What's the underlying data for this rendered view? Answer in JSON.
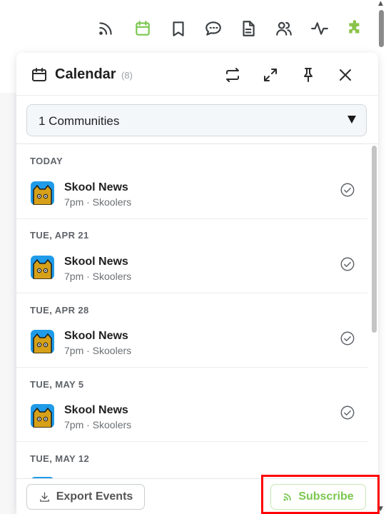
{
  "toolbar": {
    "icons": [
      "rss-icon",
      "calendar-icon",
      "bookmark-icon",
      "chat-icon",
      "document-icon",
      "users-icon",
      "activity-icon",
      "puzzle-icon"
    ],
    "active_icon": "calendar-icon",
    "active_color": "#7ac74f"
  },
  "panel": {
    "title": "Calendar",
    "count": "(8)",
    "header_icons": [
      "calendar-icon",
      "repeat-icon",
      "expand-icon",
      "pin-icon",
      "close-icon"
    ]
  },
  "filter": {
    "selected": "1 Communities"
  },
  "days": [
    {
      "label": "TODAY",
      "event": {
        "title": "Skool News",
        "subtitle": "7pm · Skoolers"
      }
    },
    {
      "label": "TUE, APR 21",
      "event": {
        "title": "Skool News",
        "subtitle": "7pm · Skoolers"
      }
    },
    {
      "label": "TUE, APR 28",
      "event": {
        "title": "Skool News",
        "subtitle": "7pm · Skoolers"
      }
    },
    {
      "label": "TUE, MAY 5",
      "event": {
        "title": "Skool News",
        "subtitle": "7pm · Skoolers"
      }
    },
    {
      "label": "TUE, MAY 12"
    }
  ],
  "footer": {
    "export_label": "Export Events",
    "subscribe_label": "Subscribe"
  },
  "colors": {
    "accent": "#7ac74f",
    "avatar_bg": "#1f9be8",
    "highlight": "#ff0000"
  }
}
